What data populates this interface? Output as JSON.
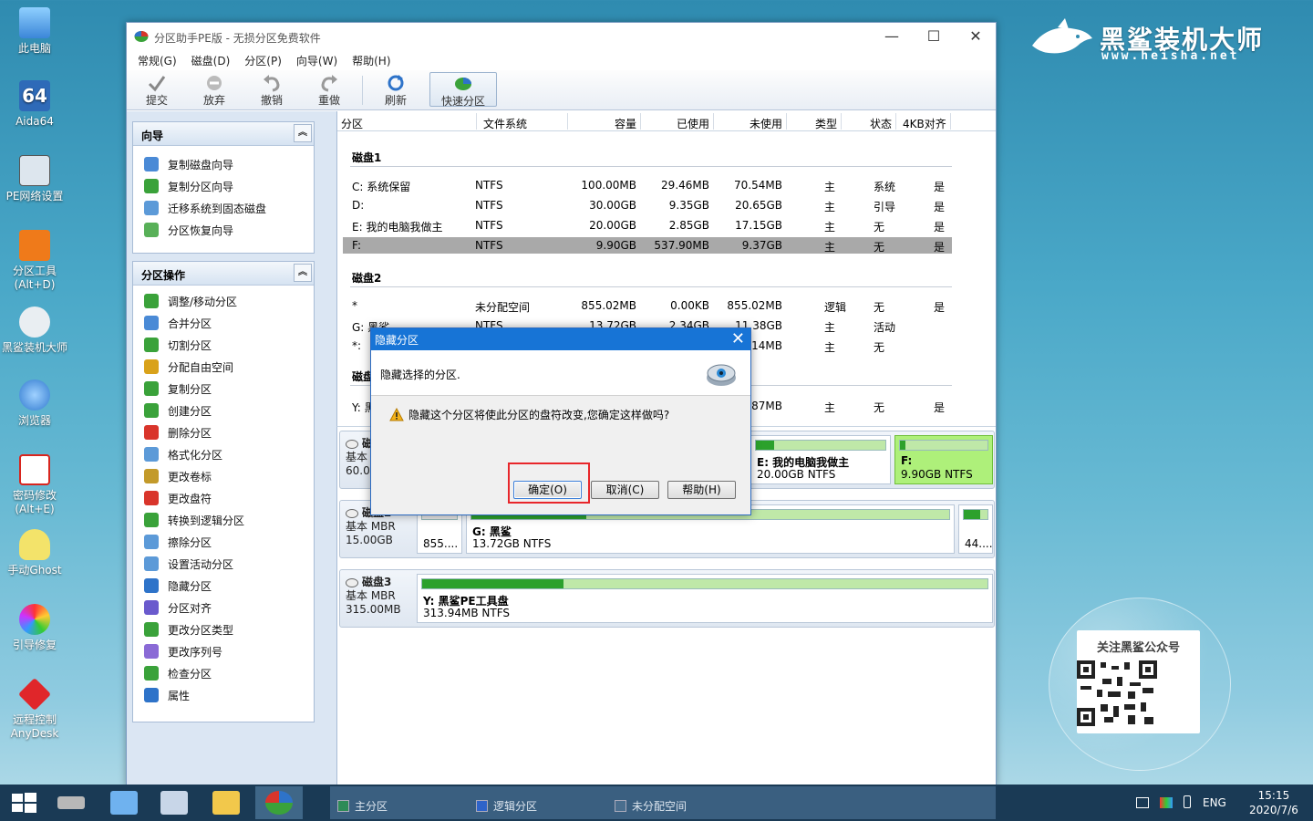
{
  "desktop": {
    "icons": [
      {
        "label": "此电脑",
        "color": "#5aa0e6"
      },
      {
        "label": "Aida64",
        "color": "#2e6ab8"
      },
      {
        "label": "PE网络设置",
        "color": "#d9e4ee"
      },
      {
        "label": "分区工具(Alt+D)",
        "color": "#ef7a1a"
      },
      {
        "label": "黑鲨装机大师",
        "color": "#e9eef2"
      },
      {
        "label": "浏览器",
        "color": "#3a8ee0"
      },
      {
        "label": "密码修改(Alt+E)",
        "color": "#d8251e"
      },
      {
        "label": "手动Ghost",
        "color": "#f3e36a"
      },
      {
        "label": "引导修复",
        "color": "#f08a24"
      },
      {
        "label": "远程控制AnyDesk",
        "color": "#e0262a"
      }
    ],
    "brand_title": "黑鲨装机大师",
    "brand_url": "www.heisha.net",
    "qr_title": "关注黑鲨公众号"
  },
  "window": {
    "title": "分区助手PE版 - 无损分区免费软件",
    "menu": [
      "常规(G)",
      "磁盘(D)",
      "分区(P)",
      "向导(W)",
      "帮助(H)"
    ],
    "toolbar": {
      "commit": "提交",
      "discard": "放弃",
      "undo": "撤销",
      "redo": "重做",
      "refresh": "刷新",
      "quick_partition": "快速分区"
    }
  },
  "wizard_panel": {
    "title": "向导",
    "items": [
      "复制磁盘向导",
      "复制分区向导",
      "迁移系统到固态磁盘",
      "分区恢复向导"
    ]
  },
  "ops_panel": {
    "title": "分区操作",
    "items": [
      "调整/移动分区",
      "合并分区",
      "切割分区",
      "分配自由空间",
      "复制分区",
      "创建分区",
      "删除分区",
      "格式化分区",
      "更改卷标",
      "更改盘符",
      "转换到逻辑分区",
      "擦除分区",
      "设置活动分区",
      "隐藏分区",
      "分区对齐",
      "更改分区类型",
      "更改序列号",
      "检查分区",
      "属性"
    ]
  },
  "table": {
    "headers": [
      "分区",
      "文件系统",
      "容量",
      "已使用",
      "未使用",
      "类型",
      "状态",
      "4KB对齐"
    ],
    "disk1_label": "磁盘1",
    "disk2_label": "磁盘2",
    "disk3_label": "磁盘3",
    "disk1_rows": [
      [
        "C: 系统保留",
        "NTFS",
        "100.00MB",
        "29.46MB",
        "70.54MB",
        "主",
        "系统",
        "是"
      ],
      [
        "D:",
        "NTFS",
        "30.00GB",
        "9.35GB",
        "20.65GB",
        "主",
        "引导",
        "是"
      ],
      [
        "E: 我的电脑我做主",
        "NTFS",
        "20.00GB",
        "2.85GB",
        "17.15GB",
        "主",
        "无",
        "是"
      ],
      [
        "F:",
        "NTFS",
        "9.90GB",
        "537.90MB",
        "9.37GB",
        "主",
        "无",
        "是"
      ]
    ],
    "disk2_rows": [
      [
        "*",
        "未分配空间",
        "855.02MB",
        "0.00KB",
        "855.02MB",
        "逻辑",
        "无",
        "是"
      ],
      [
        "G: 黑鲨",
        "NTFS",
        "13.72GB",
        "2.34GB",
        "11.38GB",
        "主",
        "活动",
        ""
      ],
      [
        "*:",
        "",
        "",
        "",
        "44.14MB",
        "主",
        "无",
        ""
      ]
    ],
    "disk3_rows": [
      [
        "Y: 黑鲨PE工具盘",
        "",
        "",
        "",
        "0.87MB",
        "主",
        "无",
        "是"
      ]
    ]
  },
  "disk_map": {
    "disk1": {
      "name": "磁盘1",
      "type": "基本",
      "size": "60.0",
      "e_name": "E: 我的电脑我做主",
      "e_desc": "20.00GB NTFS",
      "f_name": "F:",
      "f_desc": "9.90GB NTFS"
    },
    "disk2": {
      "name": "磁盘2",
      "type": "基本 MBR",
      "size": "15.00GB",
      "unalloc": "855....",
      "g_name": "G: 黑鲨",
      "g_desc": "13.72GB NTFS",
      "tail": "44...."
    },
    "disk3": {
      "name": "磁盘3",
      "type": "基本 MBR",
      "size": "315.00MB",
      "y_name": "Y: 黑鲨PE工具盘",
      "y_desc": "313.94MB NTFS"
    }
  },
  "legend": {
    "primary": "主分区",
    "logical": "逻辑分区",
    "unallocated": "未分配空间"
  },
  "tray": {
    "lang": "ENG",
    "time": "15:15",
    "date": "2020/7/6"
  },
  "dialog": {
    "title": "隐藏分区",
    "subtitle": "隐藏选择的分区.",
    "warning": "隐藏这个分区将使此分区的盘符改变,您确定这样做吗?",
    "ok": "确定(O)",
    "cancel": "取消(C)",
    "help": "帮助(H)"
  },
  "colors": {
    "accent": "#1774d6",
    "primary_part": "#2ca12c",
    "selected_part": "#aef07a",
    "highlight": "#e8262a"
  }
}
